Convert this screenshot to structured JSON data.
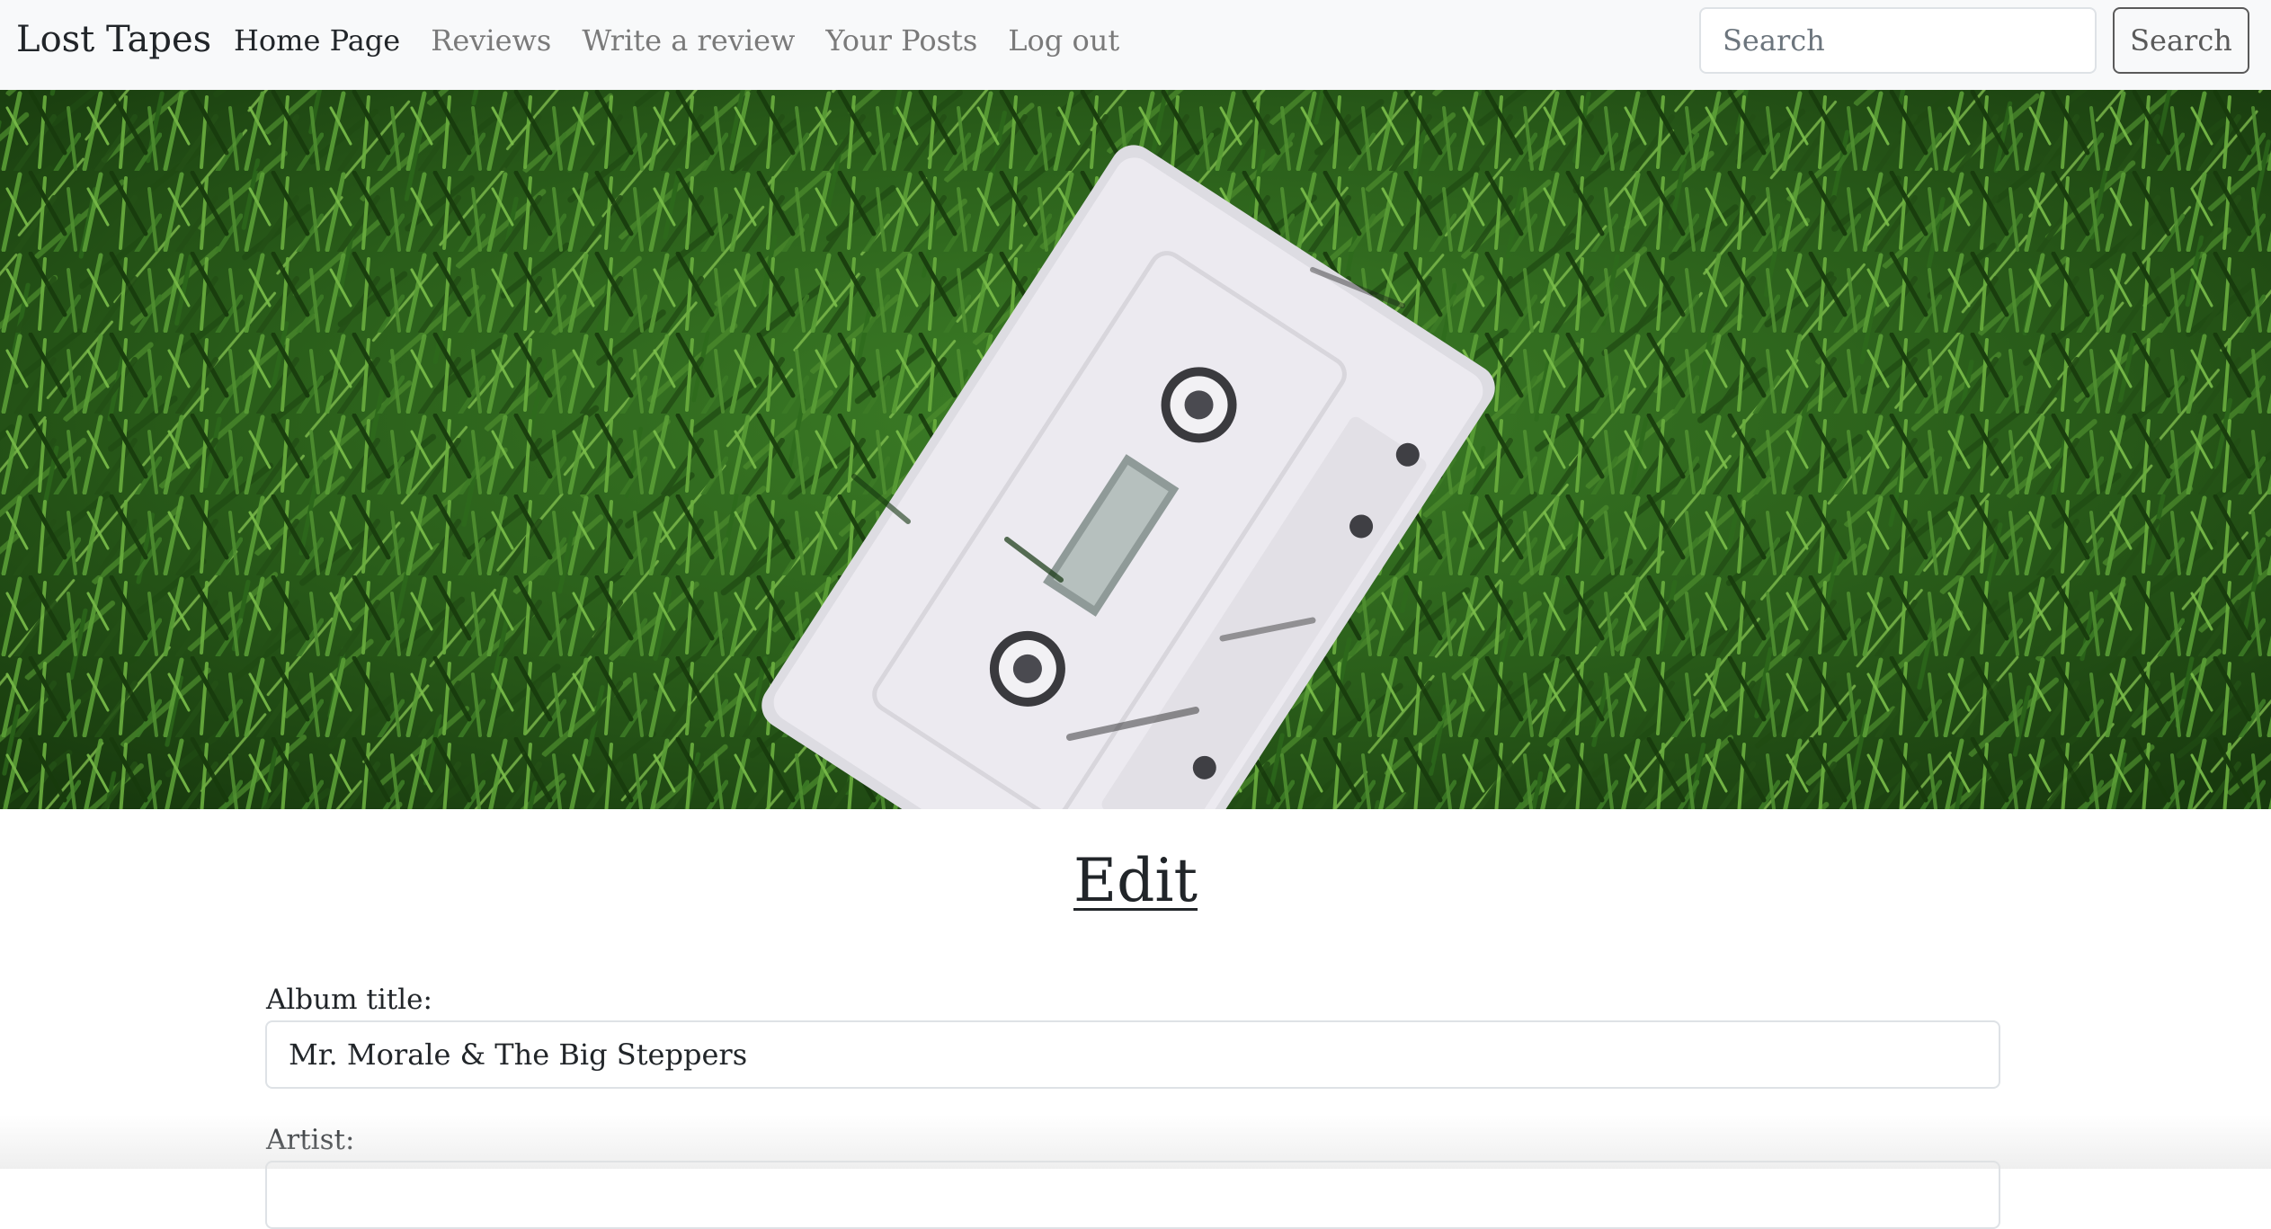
{
  "navbar": {
    "brand": "Lost Tapes",
    "links": [
      {
        "label": "Home Page",
        "active": true
      },
      {
        "label": "Reviews",
        "active": false
      },
      {
        "label": "Write a review",
        "active": false
      },
      {
        "label": "Your Posts",
        "active": false
      },
      {
        "label": "Log out",
        "active": false
      }
    ],
    "search": {
      "placeholder": "Search",
      "button_label": "Search"
    }
  },
  "hero": {
    "image": "white cassette tape lying on green grass"
  },
  "form": {
    "title": "Edit",
    "fields": [
      {
        "label": "Album title:",
        "value": "Mr. Morale & The Big Steppers"
      },
      {
        "label": "Artist:",
        "value": ""
      }
    ]
  },
  "colors": {
    "navbar_bg": "#f8f9fa",
    "link_muted": "#7a7a7a",
    "text": "#212529",
    "grass": "#2f6b1f",
    "cassette": "#e9e8ec"
  }
}
